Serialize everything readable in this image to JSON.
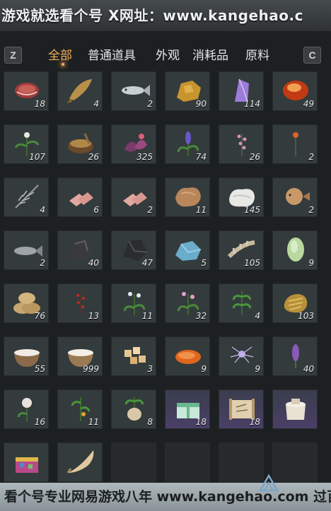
{
  "banner_top": "游戏就选看个号 X网址：www.kangehao.c",
  "banner_bottom": "看个号专业网易游戏八年  www.kangehao.com  过百亿",
  "keys": {
    "left": "Z",
    "right": "C"
  },
  "tabs": [
    {
      "label": "全部",
      "active": true
    },
    {
      "label": "普通道具",
      "active": false
    },
    {
      "label": "外观",
      "active": false
    },
    {
      "label": "消耗品",
      "active": false
    },
    {
      "label": "原料",
      "active": false
    }
  ],
  "colors": {
    "accent": "#f2b056",
    "slot_bg": "#343b3d",
    "panel_bg": "#1d2022"
  },
  "items": [
    {
      "icon": "raw-meat-icon",
      "qty": "18"
    },
    {
      "icon": "fish-dried-icon",
      "qty": "4"
    },
    {
      "icon": "silver-fish-icon",
      "qty": "2"
    },
    {
      "icon": "gold-ore-icon",
      "qty": "90"
    },
    {
      "icon": "amethyst-icon",
      "qty": "114"
    },
    {
      "icon": "amber-stone-icon",
      "qty": "49"
    },
    {
      "icon": "white-flower-herb-icon",
      "qty": "107"
    },
    {
      "icon": "herb-bowl-icon",
      "qty": "26"
    },
    {
      "icon": "purple-leaves-icon",
      "qty": "325"
    },
    {
      "icon": "lavender-icon",
      "qty": "74"
    },
    {
      "icon": "pink-flower-herb-icon",
      "qty": "26"
    },
    {
      "icon": "orange-flower-icon",
      "qty": "2"
    },
    {
      "icon": "feather-icon",
      "qty": "4"
    },
    {
      "icon": "meat-slices-icon",
      "qty": "6"
    },
    {
      "icon": "meat-slices-icon",
      "qty": "2"
    },
    {
      "icon": "leather-hide-icon",
      "qty": "11"
    },
    {
      "icon": "white-fur-icon",
      "qty": "145"
    },
    {
      "icon": "pufferfish-icon",
      "qty": "2"
    },
    {
      "icon": "grey-fish-icon",
      "qty": "2"
    },
    {
      "icon": "dark-ore-icon",
      "qty": "40"
    },
    {
      "icon": "black-ore-icon",
      "qty": "47"
    },
    {
      "icon": "blue-crystal-icon",
      "qty": "5"
    },
    {
      "icon": "bone-icon",
      "qty": "105"
    },
    {
      "icon": "melon-icon",
      "qty": "9"
    },
    {
      "icon": "grain-sacks-icon",
      "qty": "76"
    },
    {
      "icon": "red-berry-branch-icon",
      "qty": "13"
    },
    {
      "icon": "white-blossom-herb-icon",
      "qty": "11"
    },
    {
      "icon": "pink-blossom-herb-icon",
      "qty": "32"
    },
    {
      "icon": "green-herb-icon",
      "qty": "4"
    },
    {
      "icon": "gold-tablet-icon",
      "qty": "103"
    },
    {
      "icon": "milk-bowl-icon",
      "qty": "55"
    },
    {
      "icon": "rice-bowl-icon",
      "qty": "999"
    },
    {
      "icon": "gem-cubes-icon",
      "qty": "3"
    },
    {
      "icon": "orange-slice-icon",
      "qty": "9"
    },
    {
      "icon": "spider-lily-icon",
      "qty": "9"
    },
    {
      "icon": "purple-spike-flower-icon",
      "qty": "40"
    },
    {
      "icon": "white-rose-icon",
      "qty": "16"
    },
    {
      "icon": "orange-fruit-branch-icon",
      "qty": "11"
    },
    {
      "icon": "root-plant-icon",
      "qty": "8"
    },
    {
      "icon": "gift-box-icon",
      "qty": "18"
    },
    {
      "icon": "scroll-map-icon",
      "qty": "18"
    },
    {
      "icon": "jar-icon",
      "qty": ""
    },
    {
      "icon": "colorful-box-icon",
      "qty": ""
    },
    {
      "icon": "horn-icon",
      "qty": ""
    }
  ]
}
